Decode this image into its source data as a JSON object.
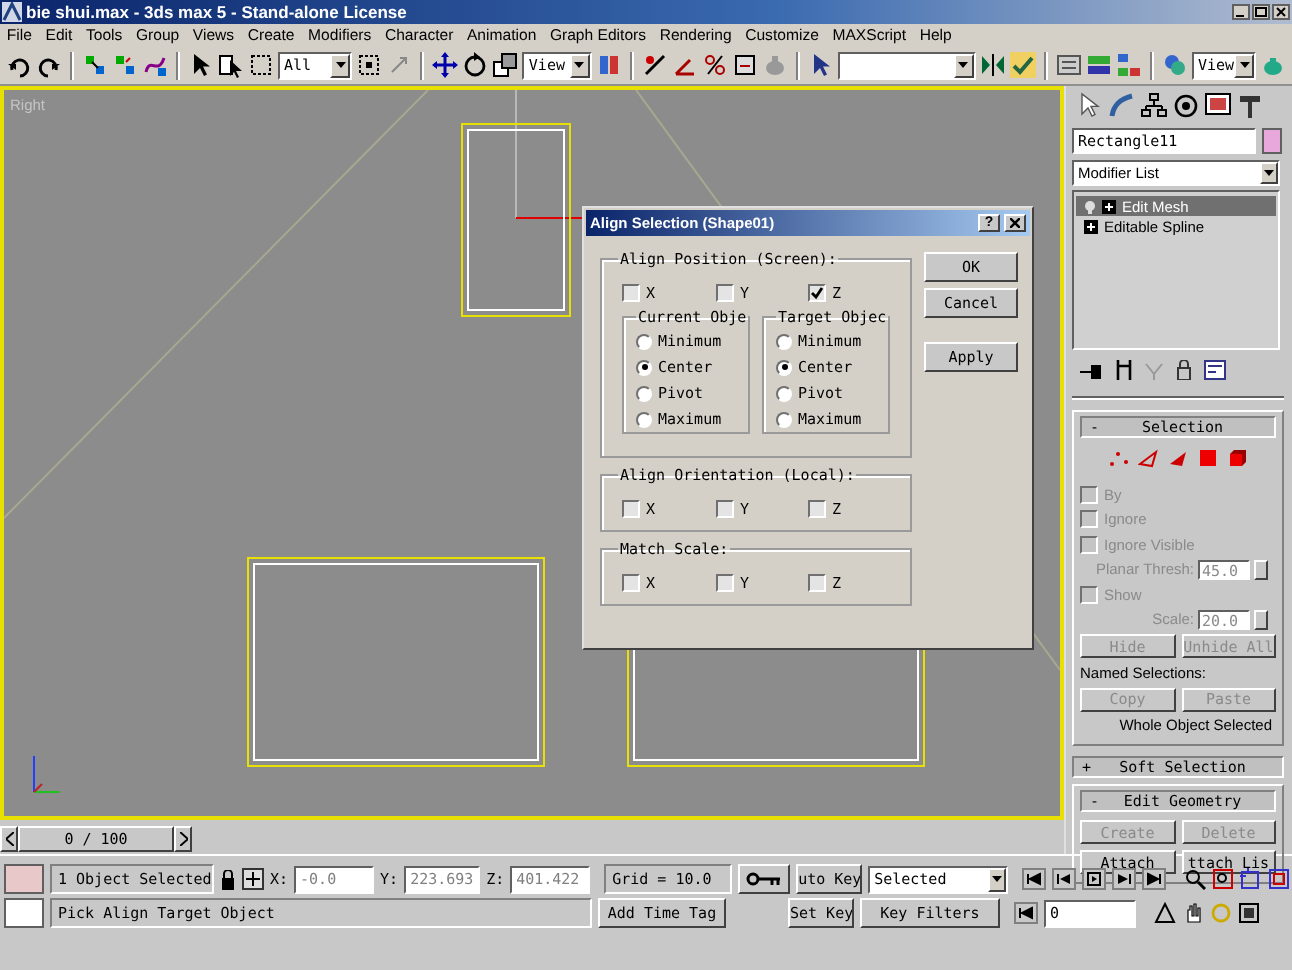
{
  "window": {
    "title": "bie shui.max - 3ds max 5 - Stand-alone License"
  },
  "menu": [
    "File",
    "Edit",
    "Tools",
    "Group",
    "Views",
    "Create",
    "Modifiers",
    "Character",
    "Animation",
    "Graph Editors",
    "Rendering",
    "Customize",
    "MAXScript",
    "Help"
  ],
  "toolbar": {
    "selection_filter": "All",
    "reference_coordinates": "View",
    "render_view": "View"
  },
  "viewport": {
    "label": "Right"
  },
  "dialog": {
    "title": "Align Selection (Shape01)",
    "help_button": "?",
    "align_position": {
      "label": "Align Position (Screen):",
      "axes": [
        {
          "label": "X",
          "checked": false
        },
        {
          "label": "Y",
          "checked": false
        },
        {
          "label": "Z",
          "checked": true
        }
      ]
    },
    "current_object": {
      "label": "Current Obje",
      "options": [
        {
          "label": "Minimum",
          "selected": false
        },
        {
          "label": "Center",
          "selected": true
        },
        {
          "label": "Pivot",
          "selected": false
        },
        {
          "label": "Maximum",
          "selected": false
        }
      ]
    },
    "target_object": {
      "label": "Target Objec",
      "options": [
        {
          "label": "Minimum",
          "selected": false
        },
        {
          "label": "Center",
          "selected": true
        },
        {
          "label": "Pivot",
          "selected": false
        },
        {
          "label": "Maximum",
          "selected": false
        }
      ]
    },
    "align_orientation": {
      "label": "Align Orientation (Local):",
      "axes": [
        {
          "label": "X",
          "checked": false
        },
        {
          "label": "Y",
          "checked": false
        },
        {
          "label": "Z",
          "checked": false
        }
      ]
    },
    "match_scale": {
      "label": "Match Scale:",
      "axes": [
        {
          "label": "X",
          "checked": false
        },
        {
          "label": "Y",
          "checked": false
        },
        {
          "label": "Z",
          "checked": false
        }
      ]
    },
    "buttons": [
      {
        "label": "OK"
      },
      {
        "label": "Cancel"
      },
      {
        "label": "Apply"
      }
    ]
  },
  "command_panel": {
    "object_name": "Rectangle11",
    "modifier_list": "Modifier List",
    "stack": [
      {
        "label": "Edit Mesh",
        "selected": true
      },
      {
        "label": "Editable Spline",
        "selected": false
      }
    ],
    "selection": {
      "sign": "-",
      "title": "Selection",
      "rows": [
        {
          "kind": "checkbox",
          "label": "By",
          "checked": false,
          "disabled": true
        },
        {
          "kind": "checkbox",
          "label": "Ignore",
          "checked": false,
          "disabled": true
        },
        {
          "kind": "checkbox",
          "label": "Ignore Visible",
          "checked": false,
          "disabled": true
        },
        {
          "kind": "spinner",
          "label": "Planar Thresh:",
          "value": "45.0",
          "disabled": true
        },
        {
          "kind": "checkbox",
          "label": "Show",
          "checked": false,
          "disabled": true
        },
        {
          "kind": "spinner",
          "label": "Scale:",
          "value": "20.0",
          "disabled": true
        },
        {
          "kind": "buttons",
          "buttons": [
            {
              "label": "Hide",
              "disabled": true
            },
            {
              "label": "Unhide All",
              "disabled": true
            }
          ]
        },
        {
          "kind": "text",
          "text": "Named Selections:"
        },
        {
          "kind": "buttons",
          "buttons": [
            {
              "label": "Copy",
              "disabled": true
            },
            {
              "label": "Paste",
              "disabled": true
            }
          ]
        },
        {
          "kind": "note",
          "text": "Whole Object Selected"
        }
      ]
    },
    "soft_selection": {
      "sign": "+",
      "title": "Soft Selection"
    },
    "edit_geometry": {
      "sign": "-",
      "title": "Edit Geometry",
      "buttons": [
        {
          "label": "Create",
          "disabled": true
        },
        {
          "label": "Delete",
          "disabled": true
        },
        {
          "label": "Attach",
          "disabled": false
        },
        {
          "label": "ttach Lis",
          "disabled": false
        }
      ]
    }
  },
  "time_slider": {
    "label": "0 / 100"
  },
  "status": {
    "selection": "1 Object Selected",
    "prompt": "Pick Align Target Object",
    "x": {
      "label": "X:",
      "value": "-0.0"
    },
    "y": {
      "label": "Y:",
      "value": "223.693"
    },
    "z": {
      "label": "Z:",
      "value": "401.422"
    },
    "grid": "Grid = 10.0",
    "add_time_tag": "Add Time Tag",
    "auto_key": "uto Key",
    "set_key": "Set Key",
    "key_mode": "Selected",
    "key_filters": "Key Filters",
    "frame": "0"
  }
}
